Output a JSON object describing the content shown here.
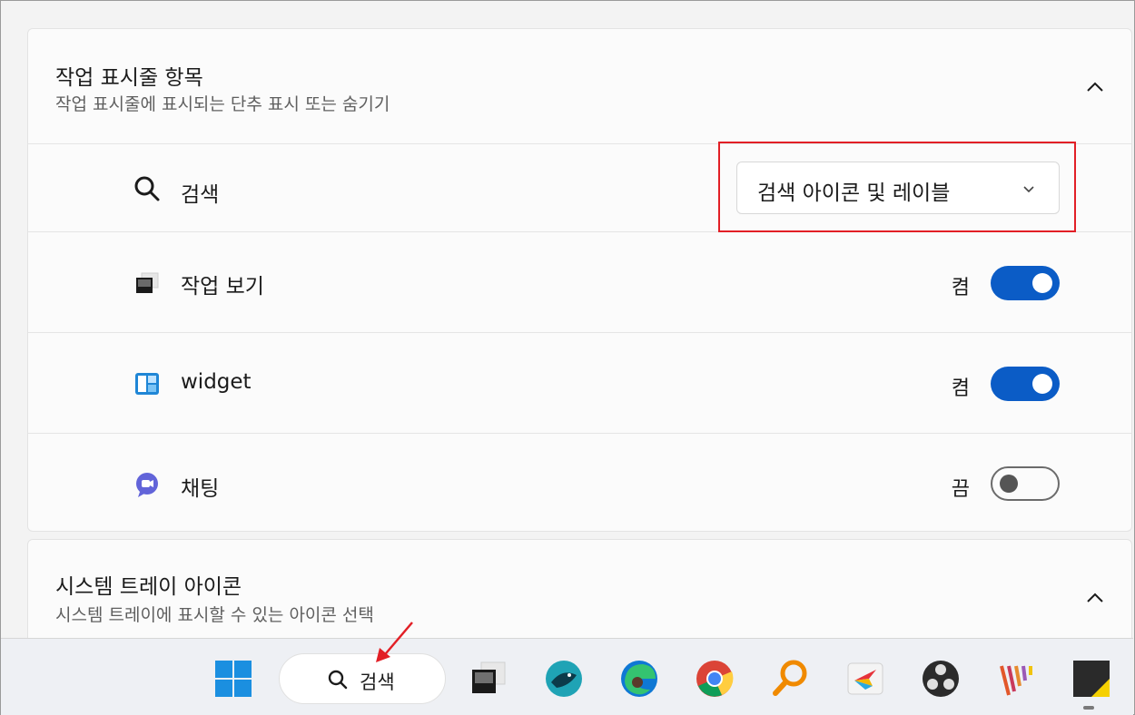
{
  "taskbar_section": {
    "title": "작업 표시줄 항목",
    "subtitle": "작업 표시줄에 표시되는 단추 표시 또는 숨기기",
    "rows": [
      {
        "label": "검색",
        "icon": "search-icon",
        "control": "dropdown",
        "value": "검색 아이콘 및 레이블"
      },
      {
        "label": "작업 보기",
        "icon": "task-view-icon",
        "control": "toggle",
        "state": "켬",
        "on": true
      },
      {
        "label": "widget",
        "icon": "widgets-icon",
        "control": "toggle",
        "state": "켬",
        "on": true
      },
      {
        "label": "채팅",
        "icon": "chat-icon",
        "control": "toggle",
        "state": "끔",
        "on": false
      }
    ]
  },
  "tray_section": {
    "title": "시스템 트레이 아이콘",
    "subtitle": "시스템 트레이에 표시할 수 있는 아이콘 선택"
  },
  "taskbar": {
    "search_label": "검색",
    "apps": [
      "start-icon",
      "task-view-icon",
      "whale-browser-icon",
      "edge-icon",
      "chrome-icon",
      "search-magnifier-app-icon",
      "pen-tool-app-icon",
      "obs-icon",
      "stripes-app-icon",
      "sticky-notes-icon"
    ]
  },
  "colors": {
    "accent": "#0b5cc6",
    "highlight": "#e21f26"
  }
}
